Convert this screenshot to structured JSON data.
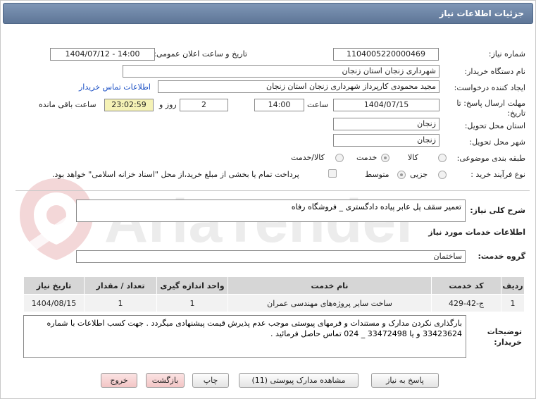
{
  "window": {
    "title": "جزئیات اطلاعات نیاز"
  },
  "need_number": {
    "label": "شماره نیاز:",
    "value": "1104005220000469"
  },
  "announce_datetime": {
    "label": "تاریخ و ساعت اعلان عمومی:",
    "value": "1404/07/12 - 14:00"
  },
  "buyer_org": {
    "label": "نام دستگاه خریدار:",
    "value": "شهرداری زنجان استان زنجان"
  },
  "requester": {
    "label": "ایجاد کننده درخواست:",
    "value": "مجید محمودی کارپرداز شهرداری زنجان استان زنجان",
    "contact_link": "اطلاعات تماس خریدار"
  },
  "deadline": {
    "label_line1": "مهلت ارسال پاسخ: تا",
    "label_line2": "تاریخ:",
    "date": "1404/07/15",
    "time_label": "ساعت",
    "time": "14:00",
    "days": "2",
    "days_label": "روز و",
    "remaining": "23:02:59",
    "remaining_label": "ساعت باقی مانده"
  },
  "delivery_province": {
    "label": "استان محل تحویل:",
    "value": "زنجان"
  },
  "delivery_city": {
    "label": "شهر محل تحویل:",
    "value": "زنجان"
  },
  "category": {
    "label": "طبقه بندی موضوعی:",
    "options": [
      "کالا",
      "خدمت",
      "کالا/خدمت"
    ],
    "selected": "خدمت"
  },
  "purchase_type": {
    "label": "نوع فرآیند خرید :",
    "options": [
      "جزیی",
      "متوسط"
    ],
    "selected": "متوسط",
    "treasury_note": "پرداخت تمام یا بخشی از مبلغ خرید،از محل \"اسناد خزانه اسلامی\" خواهد بود."
  },
  "general_description": {
    "label": "شرح کلی نیاز:",
    "value": "تعمیر سقف پل عابر پیاده دادگستری _ فروشگاه رفاه"
  },
  "services_info": {
    "heading": "اطلاعات خدمات مورد نیاز"
  },
  "service_group": {
    "label": "گروه خدمت:",
    "value": "ساختمان"
  },
  "table": {
    "headers": [
      "ردیف",
      "کد خدمت",
      "نام خدمت",
      "واحد اندازه گیری",
      "تعداد / مقدار",
      "تاریخ نیاز"
    ],
    "rows": [
      [
        "1",
        "ج-42-429",
        "ساخت سایر پروژه‌های مهندسی عمران",
        "1",
        "1",
        "1404/08/15"
      ]
    ]
  },
  "buyer_notes": {
    "label_line1": "توضیحات",
    "label_line2": "خریدار:",
    "value": "بارگذاری نکردن مدارک و مستندات و فرمهای پیوستی موجب عدم پذیرش قیمت پیشنهادی میگردد . جهت کسب اطلاعات با شماره 33423624 و یا 33472498 _ 024 تماس حاصل فرمائید ."
  },
  "buttons": {
    "reply": "پاسخ به نیاز",
    "attachments": "مشاهده مدارک پیوستی (11)",
    "print": "چاپ",
    "back": "بازگشت",
    "exit": "خروج"
  },
  "watermark": {
    "text": "AriaTender.neT"
  },
  "colors": {
    "titlebar": "#6f87a8",
    "link": "#1a4fc4",
    "remaining_bg": "#f5f2b6",
    "watermark": "#c0272d"
  }
}
